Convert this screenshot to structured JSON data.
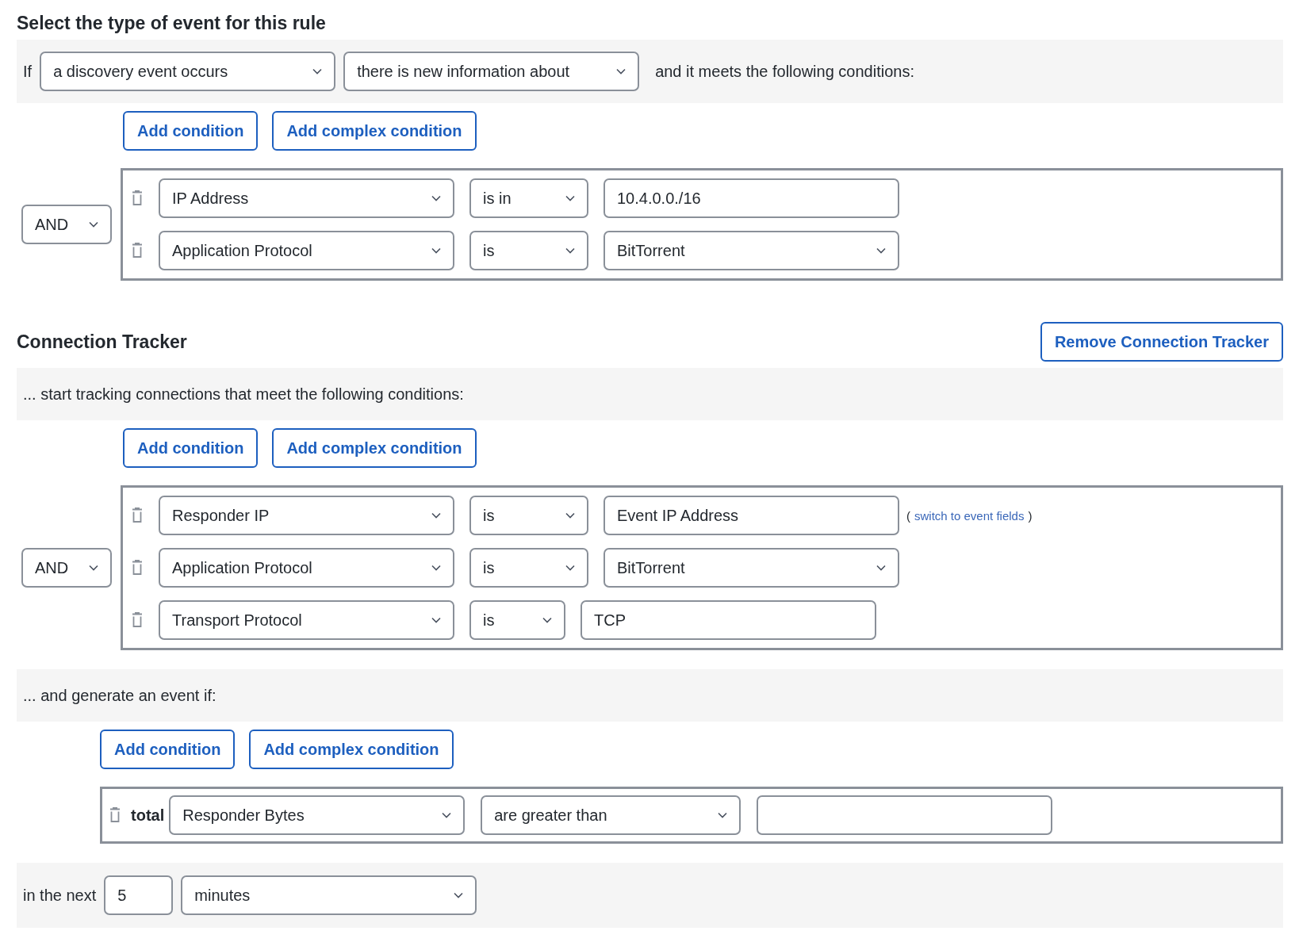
{
  "heading": "Select the type of event for this rule",
  "rule": {
    "prefix": "If",
    "selects": [
      "a discovery event occurs",
      "there is new information about"
    ],
    "suffix": "and it meets the following conditions:"
  },
  "rule_conditions": {
    "buttons": [
      "Add condition",
      "Add complex condition"
    ],
    "operator": "AND",
    "rows": [
      {
        "field": "IP Address",
        "op": "is in",
        "value": {
          "kind": "input",
          "text": "10.4.0.0./16"
        }
      },
      {
        "field": "Application Protocol",
        "op": "is",
        "value": {
          "kind": "select",
          "text": "BitTorrent"
        }
      }
    ]
  },
  "tracker": {
    "title": "Connection Tracker",
    "remove_button": "Remove Connection Tracker",
    "intro": "... start tracking connections that meet the following conditions:",
    "buttons": [
      "Add condition",
      "Add complex condition"
    ],
    "operator": "AND",
    "rows": [
      {
        "field": "Responder IP",
        "op": "is",
        "value": {
          "kind": "input",
          "text": "Event IP Address",
          "link_open": "(",
          "link": "switch to event fields",
          "link_close": ")"
        }
      },
      {
        "field": "Application Protocol",
        "op": "is",
        "value": {
          "kind": "select",
          "text": "BitTorrent"
        }
      },
      {
        "field": "Transport Protocol",
        "op": "is",
        "value": {
          "kind": "input",
          "text": "TCP"
        }
      }
    ],
    "generate": "... and generate an event if:",
    "event_buttons": [
      "Add condition",
      "Add complex condition"
    ],
    "event_row": {
      "prefix": "total",
      "field": "Responder Bytes",
      "op": "are greater than"
    },
    "window": {
      "label": "in the next",
      "count": "5",
      "unit": "minutes"
    }
  }
}
